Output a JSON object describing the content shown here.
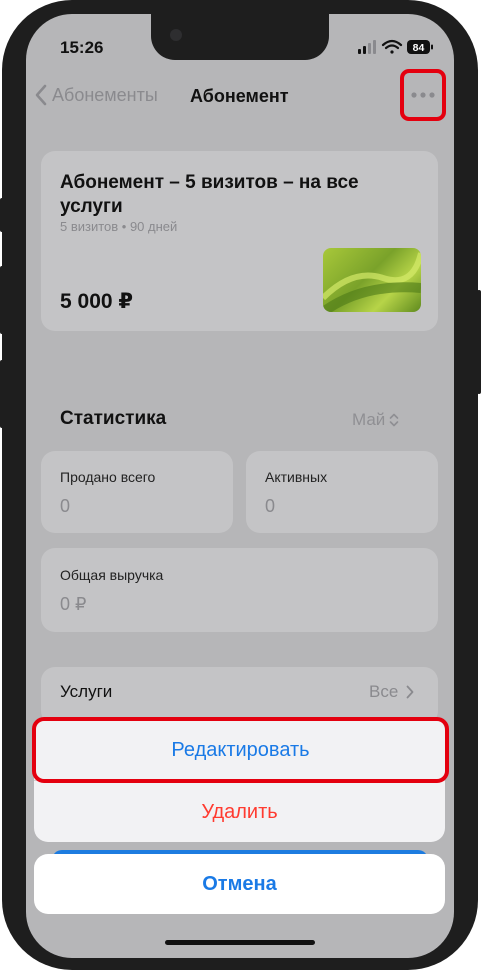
{
  "status_bar": {
    "time": "15:26",
    "battery": "84"
  },
  "nav": {
    "back_label": "Абонементы",
    "title": "Абонемент"
  },
  "subscription": {
    "title": "Абонемент – 5 визитов – на все услуги",
    "meta": "5 визитов • 90 дней",
    "price": "5 000 ₽"
  },
  "stats": {
    "heading": "Статистика",
    "month": "Май",
    "sold_label": "Продано всего",
    "sold_value": "0",
    "active_label": "Активных",
    "active_value": "0",
    "revenue_label": "Общая выручка",
    "revenue_value": "0 ₽"
  },
  "services": {
    "label": "Услуги",
    "value": "Все"
  },
  "action_sheet": {
    "edit_label": "Редактировать",
    "delete_label": "Удалить",
    "cancel_label": "Отмена"
  },
  "colors": {
    "accent": "#007aff",
    "destructive": "#ff3b30",
    "highlight": "#e4000f"
  }
}
